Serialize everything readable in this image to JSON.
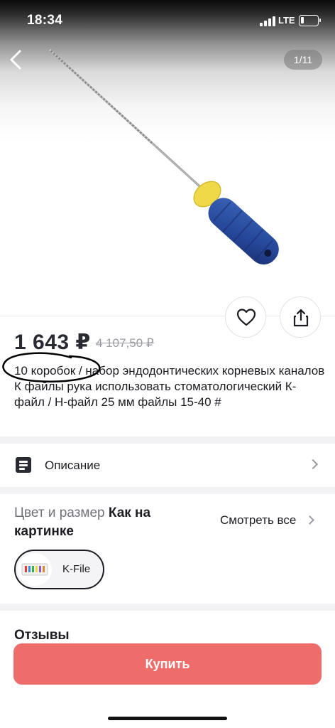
{
  "status_bar": {
    "time": "18:34",
    "network": "LTE",
    "battery_level": 0.2
  },
  "gallery": {
    "counter": "1/11",
    "icons": {
      "back": "chevron-left-icon",
      "favorite": "heart-icon",
      "share": "share-icon"
    }
  },
  "product": {
    "price": "1 643 ₽",
    "old_price": "4 107,50 ₽",
    "title": "10 коробок / набор эндодонтических корневых каналов К файлы рука использовать стоматологический К-файл / Н-файл 25 мм файлы 15-40 #"
  },
  "description": {
    "label": "Описание",
    "icon": "document-icon"
  },
  "color_size": {
    "label": "Цвет и размер",
    "value": "Как на картинке",
    "see_all": "Смотреть все",
    "variants": [
      {
        "label": "K-File",
        "selected": true
      }
    ]
  },
  "reviews": {
    "title": "Отзывы"
  },
  "buy_button": {
    "label": "Купить"
  },
  "colors": {
    "accent": "#ee6d6a",
    "handle": "#2b4f9a",
    "stopper": "#f0d948"
  }
}
